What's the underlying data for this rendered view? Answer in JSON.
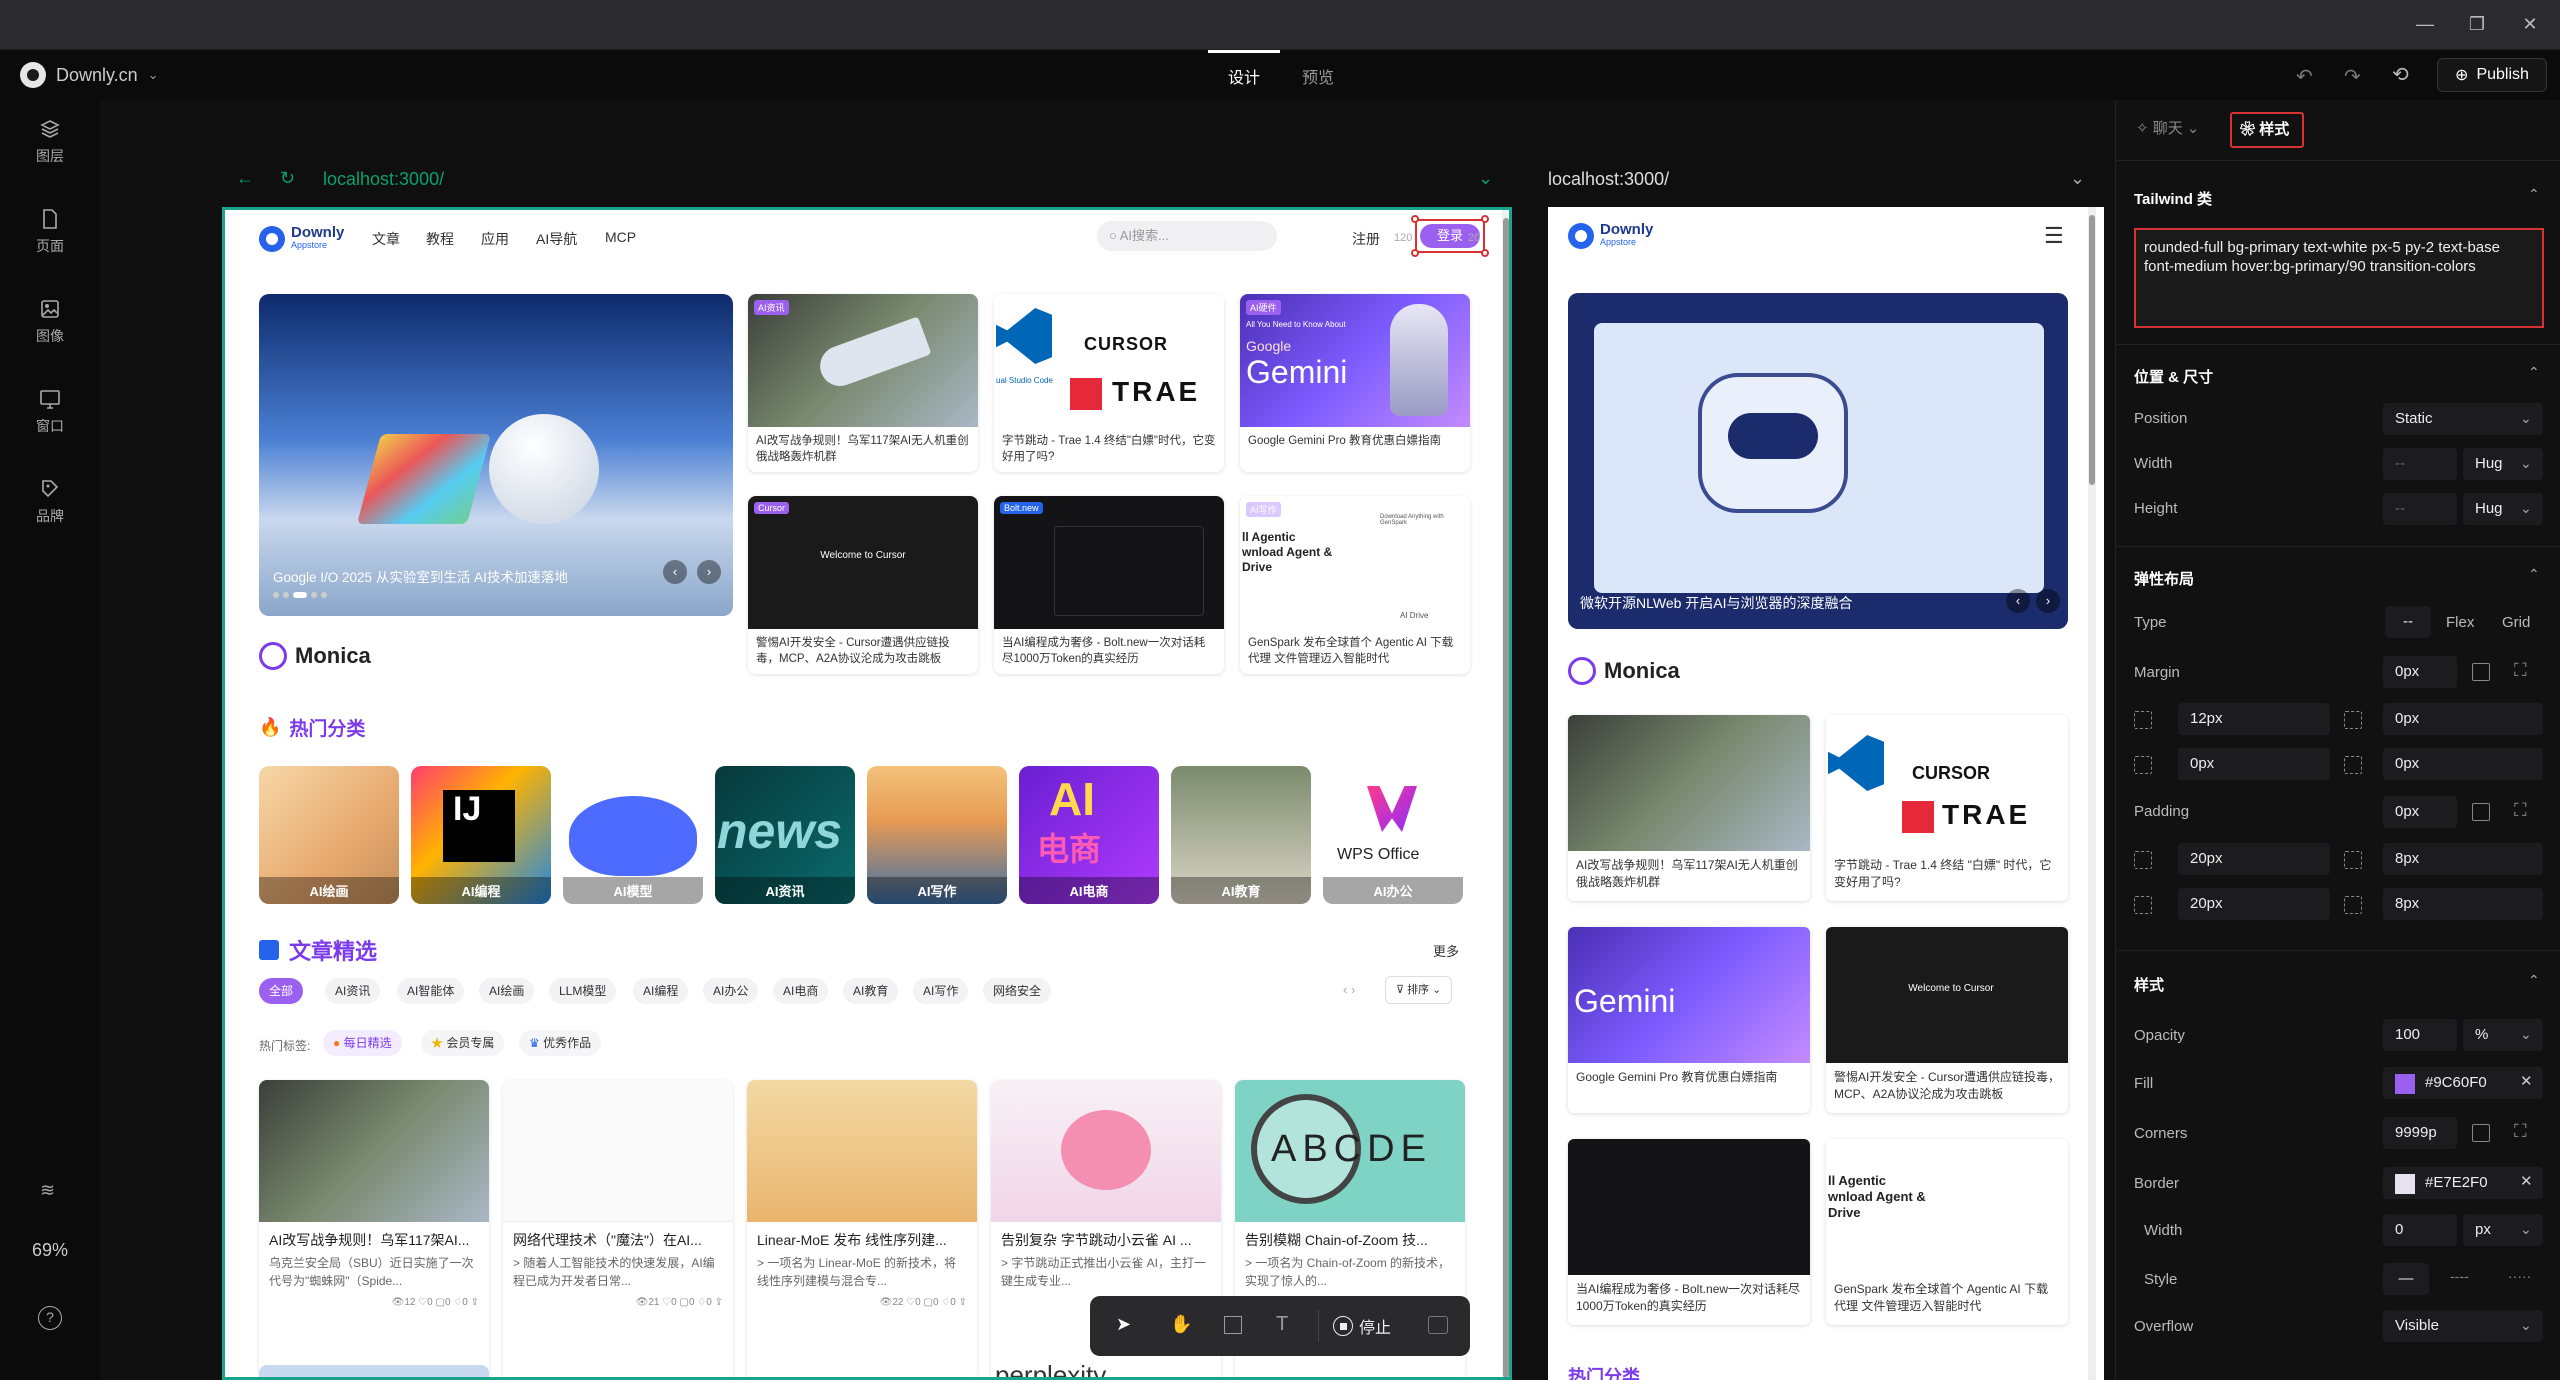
{
  "window": {
    "minimize": "—",
    "maximize": "❐",
    "close": "✕"
  },
  "app": {
    "workspace": "Downly.cn",
    "tabs": [
      "设计",
      "预览"
    ],
    "active_tab": "设计",
    "publish": "Publish"
  },
  "leftbar": {
    "items": [
      "图层",
      "页面",
      "图像",
      "窗口",
      "品牌"
    ],
    "zoom": "69%"
  },
  "desktop_preview": {
    "url": "localhost:3000/",
    "site": {
      "logo_top": "Downly",
      "logo_bottom": "Appstore",
      "nav": [
        "文章",
        "教程",
        "应用",
        "AI导航",
        "MCP"
      ],
      "search_placeholder": "AI搜索...",
      "register": "注册",
      "login": "登录",
      "login_dims_left": "120",
      "login_dims_right": "20"
    },
    "hero": {
      "caption": "Google I/O 2025 从实验室到生活 AI技术加速落地"
    },
    "grid_cards": [
      {
        "badge": "AI资讯",
        "text": "AI改写战争规则！乌军117架AI无人机重创俄战略轰炸机群"
      },
      {
        "badge": "",
        "text": "字节跳动 - Trae 1.4 终结\"白嫖\"时代，它变好用了吗?"
      },
      {
        "badge": "AI硬件",
        "text": "Google Gemini Pro 教育优惠白嫖指南"
      },
      {
        "badge": "Cursor",
        "text": "警惕AI开发安全 - Cursor遭遇供应链投毒，MCP、A2A协议沦成为攻击跳板"
      },
      {
        "badge": "Bolt.new",
        "text": "当AI编程成为奢侈 - Bolt.new一次对话耗尽1000万Token的真实经历"
      },
      {
        "badge": "AI写作",
        "text": "GenSpark 发布全球首个 Agentic AI 下载代理 文件管理迈入智能时代"
      }
    ],
    "card_texts": {
      "cursor": "CURSOR",
      "trae": "TRAE",
      "gemini_small": "All You Need to Know About",
      "google": "Google",
      "gemini": "Gemini",
      "vscode": "ual Studio Code",
      "welcome": "Welcome to Cursor",
      "agentic": "ll Agentic wnload Agent & Drive",
      "genspark": "Download Anything with GenSpark",
      "ai_drive": "AI Drive"
    },
    "monica": "Monica",
    "hot_title": "热门分类",
    "categories": [
      "AI绘画",
      "AI编程",
      "AI模型",
      "AI资讯",
      "AI写作",
      "AI电商",
      "AI教育",
      "AI办公"
    ],
    "cat_texts": {
      "ij": "IJ",
      "news": "news",
      "ai": "AI",
      "dianshang": "电商",
      "wps": "WPS Office"
    },
    "articles_title": "文章精选",
    "more": "更多",
    "filters": [
      "全部",
      "AI资讯",
      "AI智能体",
      "AI绘画",
      "LLM模型",
      "AI编程",
      "AI办公",
      "AI电商",
      "AI教育",
      "AI写作",
      "网络安全"
    ],
    "sort": "排序",
    "hot_tags_label": "热门标签:",
    "hot_tags": [
      "每日精选",
      "会员专属",
      "优秀作品"
    ],
    "articles": [
      {
        "title": "AI改写战争规则！乌军117架AI...",
        "desc": "乌克兰安全局（SBU）近日实施了一次代号为\"蜘蛛网\"（Spide...",
        "stats": "👁12  ♡0  ▢0  ♢0  ⇪"
      },
      {
        "title": "网络代理技术（\"魔法\"）在AI...",
        "desc": "> 随着人工智能技术的快速发展，AI编程已成为开发者日常...",
        "stats": "👁21  ♡0  ▢0  ♢0  ⇪"
      },
      {
        "title": "Linear-MoE 发布 线性序列建...",
        "desc": "> 一项名为 Linear-MoE 的新技术，将线性序列建模与混合专...",
        "stats": "👁22  ♡0  ▢0  ♢0  ⇪"
      },
      {
        "title": "告别复杂 字节跳动小云雀 AI ...",
        "desc": "> 字节跳动正式推出小云雀 AI，主打一键生成专业...",
        "stats": ""
      },
      {
        "title": "告别模糊 Chain-of-Zoom 技...",
        "desc": "> 一项名为 Chain-of-Zoom 的新技术，实现了惊人的...",
        "stats": ""
      }
    ],
    "abcde": "ABCDE",
    "perplexity": "perplexity"
  },
  "mobile_preview": {
    "url": "localhost:3000/",
    "hero_caption": "微软开源NLWeb 开启AI与浏览器的深度融合",
    "monica": "Monica",
    "cards": [
      {
        "text": "AI改写战争规则！乌军117架AI无人机重创俄战略轰炸机群"
      },
      {
        "text": "字节跳动 - Trae 1.4 终结 \"白嫖\" 时代，它变好用了吗?"
      },
      {
        "text": "Google Gemini Pro 教育优惠白嫖指南"
      },
      {
        "text": "警惕AI开发安全 - Cursor遭遇供应链投毒，MCP、A2A协议沦成为攻击跳板"
      },
      {
        "text": "当AI编程成为奢侈 - Bolt.new一次对话耗尽1000万Token的真实经历"
      },
      {
        "text": "GenSpark 发布全球首个 Agentic AI 下载代理 文件管理迈入智能时代"
      }
    ],
    "hot_title": "热门分类"
  },
  "panel": {
    "chat_tab": "聊天",
    "style_tab": "样式",
    "tailwind_title": "Tailwind 类",
    "tailwind_classes": "rounded-full bg-primary text-white px-5 py-2 text-base font-medium hover:bg-primary/90 transition-colors",
    "position_size_title": "位置 & 尺寸",
    "position_label": "Position",
    "position_value": "Static",
    "width_label": "Width",
    "width_value": "--",
    "width_mode": "Hug",
    "height_label": "Height",
    "height_value": "--",
    "height_mode": "Hug",
    "flex_title": "弹性布局",
    "type_label": "Type",
    "type_options": [
      "--",
      "Flex",
      "Grid"
    ],
    "margin_label": "Margin",
    "margin_value": "0px",
    "margin_sides": [
      "12px",
      "0px",
      "0px",
      "0px"
    ],
    "padding_label": "Padding",
    "padding_value": "0px",
    "padding_sides": [
      "20px",
      "8px",
      "20px",
      "8px"
    ],
    "style_title": "样式",
    "opacity_label": "Opacity",
    "opacity_value": "100",
    "opacity_unit": "%",
    "fill_label": "Fill",
    "fill_value": "#9C60F0",
    "corners_label": "Corners",
    "corners_value": "9999p",
    "border_label": "Border",
    "border_value": "#E7E2F0",
    "bwidth_label": "Width",
    "bwidth_value": "0",
    "bwidth_unit": "px",
    "bstyle_label": "Style",
    "overflow_label": "Overflow",
    "overflow_value": "Visible"
  },
  "float_toolbar": {
    "stop": "停止"
  },
  "colors": {
    "accent": "#9c60f0",
    "teal": "#18a58c",
    "green": "#0aa06e",
    "highlight_red": "#d83232",
    "orange": "#f07a1a"
  }
}
